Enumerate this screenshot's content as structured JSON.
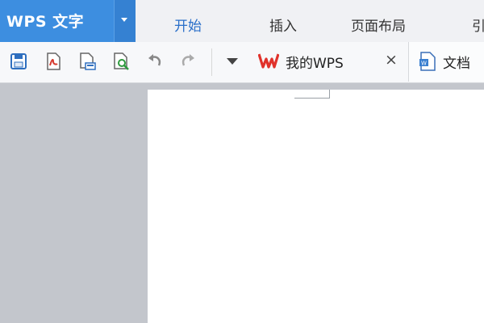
{
  "app": {
    "title": "WPS 文字",
    "accent": "#3d8ee0"
  },
  "ribbon_tabs": [
    {
      "label": "开始",
      "active": true
    },
    {
      "label": "插入",
      "active": false
    },
    {
      "label": "页面布局",
      "active": false
    },
    {
      "label": "引",
      "active": false
    }
  ],
  "quick_access": [
    {
      "icon": "save-icon"
    },
    {
      "icon": "export-pdf-icon"
    },
    {
      "icon": "print-icon"
    },
    {
      "icon": "print-preview-icon"
    },
    {
      "icon": "undo-icon"
    },
    {
      "icon": "redo-icon"
    },
    {
      "icon": "more-dropdown-icon"
    }
  ],
  "doc_tabs": [
    {
      "label": "我的WPS",
      "icon": "wps-logo-icon",
      "closable": true
    },
    {
      "label": "文档",
      "icon": "document-icon"
    }
  ]
}
